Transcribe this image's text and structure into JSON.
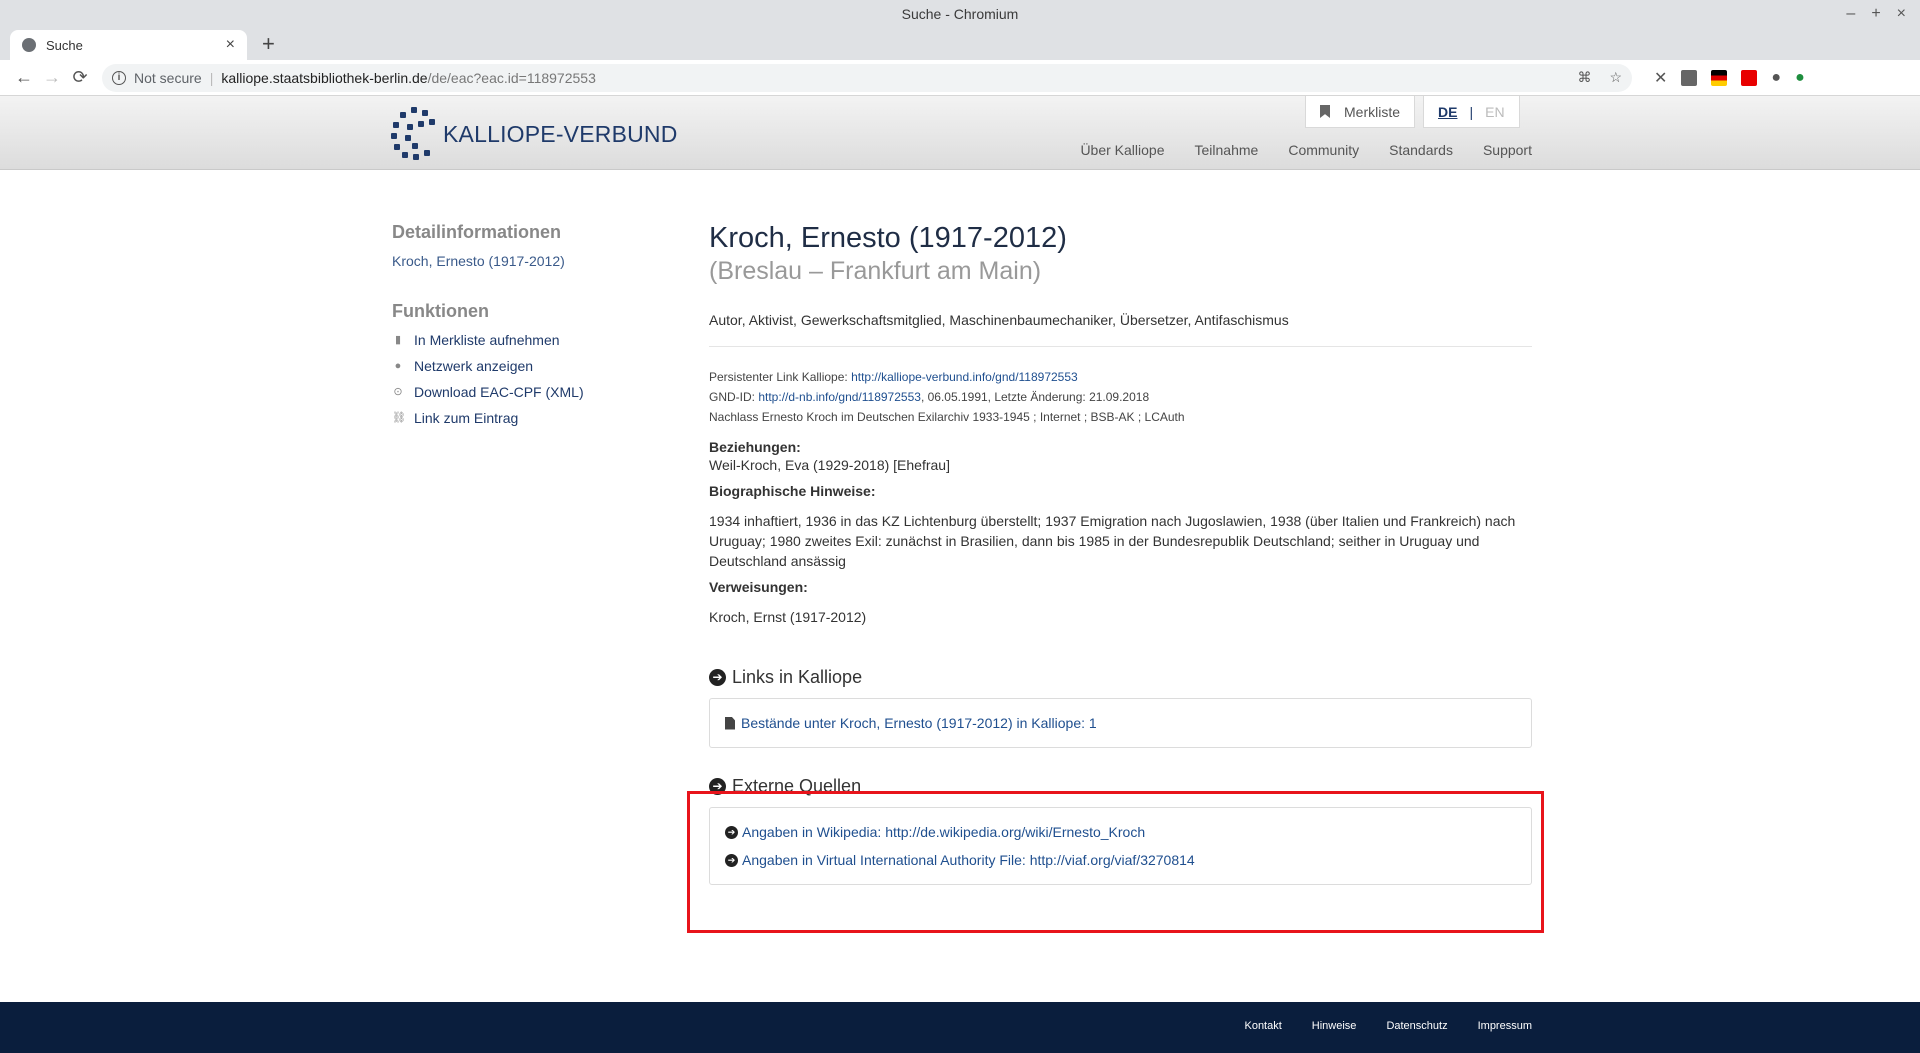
{
  "window": {
    "title": "Suche - Chromium",
    "controls": [
      "–",
      "+",
      "×"
    ]
  },
  "tab": {
    "title": "Suche",
    "close": "×",
    "newtab": "+"
  },
  "toolbar": {
    "back": "←",
    "forward": "→",
    "reload": "⟳",
    "not_secure": "Not secure",
    "url_host": "kalliope.staatsbibliothek-berlin.de",
    "url_path": "/de/eac?eac.id=118972553"
  },
  "site": {
    "logo_text": "KALLIOPE-VERBUND",
    "merkliste": "Merkliste",
    "lang_de": "DE",
    "lang_en": "EN",
    "nav": [
      "Über Kalliope",
      "Teilnahme",
      "Community",
      "Standards",
      "Support"
    ]
  },
  "sidebar": {
    "detail_heading": "Detailinformationen",
    "detail_link": "Kroch, Ernesto (1917-2012)",
    "func_heading": "Funktionen",
    "functions": [
      "In Merkliste aufnehmen",
      "Netzwerk anzeigen",
      "Download EAC-CPF (XML)",
      "Link zum Eintrag"
    ]
  },
  "record": {
    "name": "Kroch, Ernesto (1917-2012)",
    "places": "(Breslau – Frankfurt am Main)",
    "roles": "Autor, Aktivist, Gewerkschaftsmitglied, Maschinenbaumechaniker, Übersetzer, Antifaschismus",
    "persistent_label": "Persistenter Link Kalliope: ",
    "persistent_url": "http://kalliope-verbund.info/gnd/118972553",
    "gnd_label": "GND-ID: ",
    "gnd_url": "http://d-nb.info/gnd/118972553",
    "gnd_rest": ", 06.05.1991, Letzte Änderung: 21.09.2018",
    "source_line": "Nachlass Ernesto Kroch im Deutschen Exilarchiv 1933-1945 ; Internet ; BSB-AK ; LCAuth",
    "relations_label": "Beziehungen:",
    "relation": "Weil-Kroch, Eva (1929-2018) [Ehefrau]",
    "bio_label": "Biographische Hinweise:",
    "bio_text": "1934 inhaftiert, 1936 in das KZ Lichtenburg überstellt; 1937 Emigration nach Jugoslawien, 1938 (über Italien und Frankreich) nach Uruguay; 1980 zweites Exil: zunächst in Brasilien, dann bis 1985 in der Bundesrepublik Deutschland; seither in Uruguay und Deutschland ansässig",
    "ref_label": "Verweisungen:",
    "ref_text": "Kroch, Ernst (1917-2012)"
  },
  "links_section": {
    "heading": "Links in Kalliope",
    "item": "Bestände unter Kroch, Ernesto (1917-2012) in Kalliope: 1"
  },
  "external_section": {
    "heading": "Externe Quellen",
    "items": [
      "Angaben in Wikipedia: http://de.wikipedia.org/wiki/Ernesto_Kroch",
      "Angaben in Virtual International Authority File: http://viaf.org/viaf/3270814"
    ]
  },
  "footer": {
    "links": [
      "Kontakt",
      "Hinweise",
      "Datenschutz",
      "Impressum"
    ]
  },
  "colors": {
    "brand": "#1f3a6a",
    "link": "#1f4f8f",
    "footer": "#0a1e3d",
    "highlight": "#e8141b"
  }
}
